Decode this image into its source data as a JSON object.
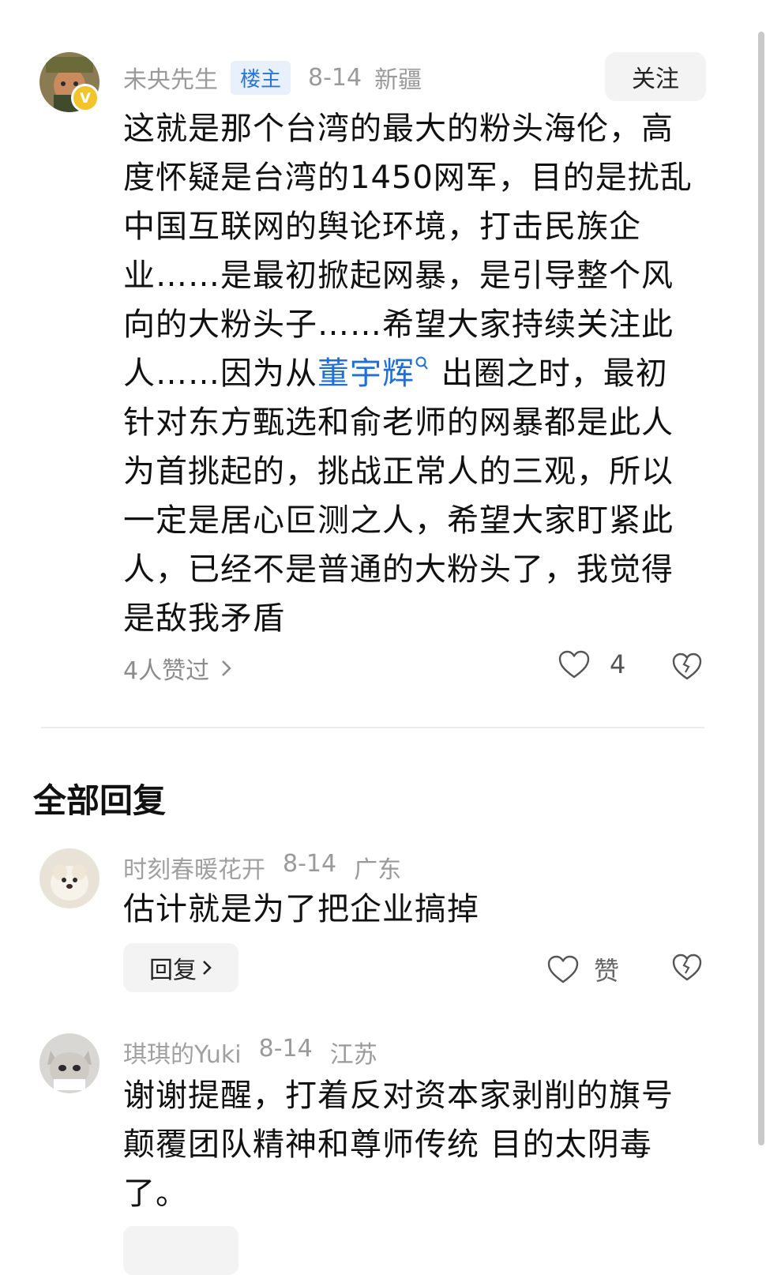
{
  "main_comment": {
    "author": "未央先生",
    "badge": "楼主",
    "date": "8-14",
    "location": "新疆",
    "follow_label": "关注",
    "text_before_link": "这就是那个台湾的最大的粉头海伦，高度怀疑是台湾的1450网军，目的是扰乱中国互联网的舆论环境，打击民族企业……是最初掀起网暴，是引导整个风向的大粉头子……希望大家持续关注此人……因为从",
    "link_text": "董宇辉",
    "text_after_link": "出圈之时，最初针对东方甄选和俞老师的网暴都是此人为首挑起的，挑战正常人的三观，所以一定是居心叵测之人，希望大家盯紧此人，已经不是普通的大粉头了，我觉得是敌我矛盾",
    "likers_text": "4人赞过",
    "like_count": "4",
    "icons": [
      "avatar-verified-icon",
      "search-icon",
      "chevron-right-icon",
      "heart-icon",
      "broken-heart-icon"
    ]
  },
  "section_title": "全部回复",
  "replies": [
    {
      "author": "时刻春暖花开",
      "date": "8-14",
      "location": "广东",
      "text": "估计就是为了把企业搞掉",
      "reply_label": "回复",
      "like_label": "赞"
    },
    {
      "author": "琪琪的Yuki",
      "date": "8-14",
      "location": "江苏",
      "text": "谢谢提醒，打着反对资本家剥削的旗号颠覆团队精神和尊师传统 目的太阴毒了。"
    }
  ],
  "colors": {
    "link": "#1f6fd6",
    "badge_bg": "#e8f0fb",
    "meta_text": "#9a9a9a",
    "button_bg": "#f3f3f3",
    "verified": "#f3c32b"
  }
}
